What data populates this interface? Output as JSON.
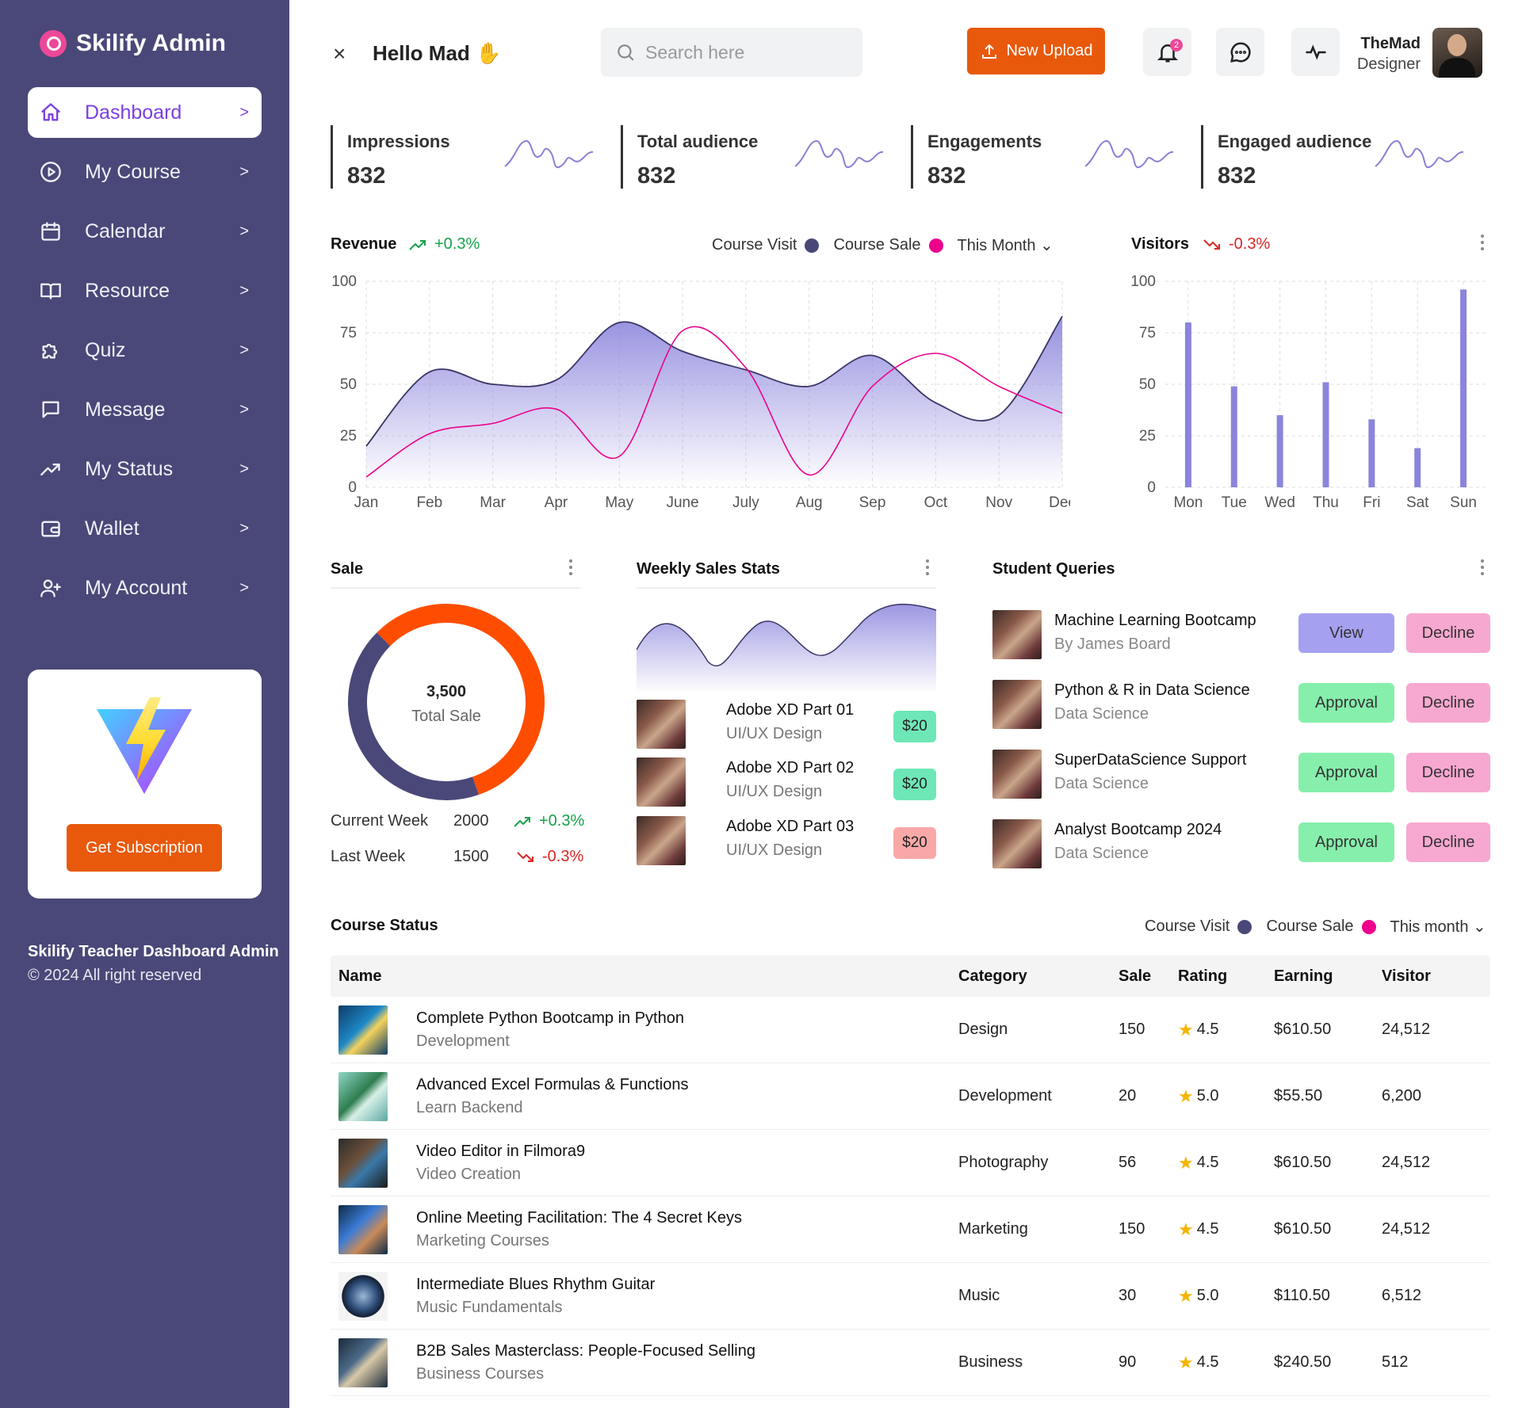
{
  "app": {
    "name": "Skilify Admin"
  },
  "sidebar": {
    "items": [
      {
        "label": "Dashboard",
        "icon": "home-icon"
      },
      {
        "label": "My Course",
        "icon": "play-circle-icon"
      },
      {
        "label": "Calendar",
        "icon": "calendar-icon"
      },
      {
        "label": "Resource",
        "icon": "book-icon"
      },
      {
        "label": "Quiz",
        "icon": "puzzle-icon"
      },
      {
        "label": "Message",
        "icon": "message-icon"
      },
      {
        "label": "My Status",
        "icon": "trend-icon"
      },
      {
        "label": "Wallet",
        "icon": "wallet-icon"
      },
      {
        "label": "My Account",
        "icon": "user-plus-icon"
      }
    ],
    "chevron": ">",
    "promo_button": "Get Subscription",
    "footer_title": "Skilify Teacher Dashboard Admin",
    "footer_copy": "© 2024 All right reserved"
  },
  "header": {
    "close": "×",
    "greeting": "Hello Mad",
    "greeting_emoji": "✋",
    "search_placeholder": "Search here",
    "upload_label": "New Upload",
    "notification_count": "2",
    "user_name": "TheMad",
    "user_role": "Designer"
  },
  "kpis": [
    {
      "label": "Impressions",
      "value": "832"
    },
    {
      "label": "Total audience",
      "value": "832"
    },
    {
      "label": "Engagements",
      "value": "832"
    },
    {
      "label": "Engaged audience",
      "value": "832"
    }
  ],
  "revenue": {
    "title": "Revenue",
    "change": "+0.3%",
    "legend_visit": "Course Visit",
    "legend_sale": "Course Sale",
    "filter": "This Month"
  },
  "visitors": {
    "title": "Visitors",
    "change": "-0.3%"
  },
  "sale": {
    "title": "Sale",
    "total": "3,500",
    "total_label": "Total Sale",
    "rows": [
      {
        "label": "Current Week",
        "value": "2000",
        "change": "+0.3%"
      },
      {
        "label": "Last Week",
        "value": "1500",
        "change": "-0.3%"
      }
    ]
  },
  "weekly": {
    "title": "Weekly Sales Stats",
    "items": [
      {
        "title": "Adobe XD Part 01",
        "sub": "UI/UX Design",
        "price": "$20",
        "status": "up"
      },
      {
        "title": "Adobe XD Part 02",
        "sub": "UI/UX Design",
        "price": "$20",
        "status": "up"
      },
      {
        "title": "Adobe XD Part 03",
        "sub": "UI/UX Design",
        "price": "$20",
        "status": "down"
      }
    ]
  },
  "queries": {
    "title": "Student Queries",
    "items": [
      {
        "title": "Machine Learning Bootcamp",
        "sub": "By James Board",
        "action": "View",
        "decline": "Decline"
      },
      {
        "title": "Python & R in Data Science",
        "sub": "Data Science",
        "action": "Approval",
        "decline": "Decline"
      },
      {
        "title": "SuperDataScience Support",
        "sub": "Data Science",
        "action": "Approval",
        "decline": "Decline"
      },
      {
        "title": "Analyst Bootcamp 2024",
        "sub": "Data Science",
        "action": "Approval",
        "decline": "Decline"
      }
    ]
  },
  "course_status": {
    "title": "Course Status",
    "legend_visit": "Course Visit",
    "legend_sale": "Course Sale",
    "filter": "This month",
    "columns": [
      "Name",
      "Category",
      "Sale",
      "Rating",
      "Earning",
      "Visitor"
    ],
    "rows": [
      {
        "name": "Complete Python Bootcamp in Python",
        "sub": "Development",
        "category": "Design",
        "sale": "150",
        "rating": "4.5",
        "earning": "$610.50",
        "visitor": "24,512"
      },
      {
        "name": "Advanced Excel Formulas & Functions",
        "sub": "Learn Backend",
        "category": "Development",
        "sale": "20",
        "rating": "5.0",
        "earning": "$55.50",
        "visitor": "6,200"
      },
      {
        "name": "Video Editor in Filmora9",
        "sub": "Video Creation",
        "category": "Photography",
        "sale": "56",
        "rating": "4.5",
        "earning": "$610.50",
        "visitor": "24,512"
      },
      {
        "name": "Online Meeting Facilitation: The 4 Secret Keys",
        "sub": "Marketing Courses",
        "category": "Marketing",
        "sale": "150",
        "rating": "4.5",
        "earning": "$610.50",
        "visitor": "24,512"
      },
      {
        "name": "Intermediate Blues Rhythm Guitar",
        "sub": "Music Fundamentals",
        "category": "Music",
        "sale": "30",
        "rating": "5.0",
        "earning": "$110.50",
        "visitor": "6,512"
      },
      {
        "name": "B2B Sales Masterclass: People-Focused Selling",
        "sub": "Business Courses",
        "category": "Business",
        "sale": "90",
        "rating": "4.5",
        "earning": "$240.50",
        "visitor": "512"
      }
    ]
  },
  "colors": {
    "sidebar": "#4a4878",
    "accent_orange": "#e8590c",
    "visit": "#4a4878",
    "sale": "#ec008c",
    "bar": "#8b84dc",
    "up": "#16a34a",
    "down": "#dc2626",
    "price_up": "#6ee7b7",
    "price_down": "#f9a8a8",
    "approve": "#86efac",
    "view": "#a5a1f0",
    "decline": "#f7a8d0"
  },
  "chart_data": [
    {
      "type": "area",
      "title": "Revenue",
      "categories": [
        "Jan",
        "Feb",
        "Mar",
        "Apr",
        "May",
        "June",
        "July",
        "Aug",
        "Sep",
        "Oct",
        "Nov",
        "Dec"
      ],
      "ylim": [
        0,
        100
      ],
      "yticks": [
        0,
        25,
        50,
        75,
        100
      ],
      "grid": true,
      "series": [
        {
          "name": "Course Visit",
          "values": [
            20,
            56,
            50,
            52,
            80,
            66,
            57,
            49,
            64,
            41,
            35,
            83
          ]
        },
        {
          "name": "Course Sale",
          "values": [
            5,
            26,
            31,
            38,
            15,
            76,
            58,
            6,
            49,
            65,
            49,
            36
          ]
        }
      ]
    },
    {
      "type": "bar",
      "title": "Visitors",
      "categories": [
        "Mon",
        "Tue",
        "Wed",
        "Thu",
        "Fri",
        "Sat",
        "Sun"
      ],
      "values": [
        80,
        49,
        35,
        51,
        33,
        19,
        96
      ],
      "ylim": [
        0,
        100
      ],
      "yticks": [
        0,
        25,
        50,
        75,
        100
      ],
      "grid": true
    },
    {
      "type": "pie",
      "title": "Sale",
      "categories": [
        "Current Week",
        "Last Week"
      ],
      "values": [
        2000,
        1500
      ]
    }
  ]
}
